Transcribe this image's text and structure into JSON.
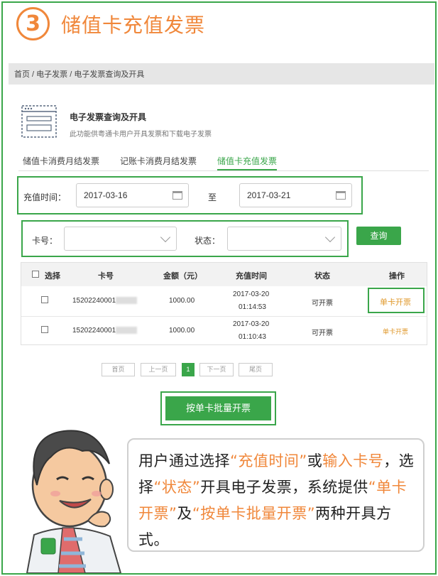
{
  "header": {
    "step": "3",
    "title": "储值卡充值发票"
  },
  "breadcrumb": "首页 / 电子发票 / 电子发票查询及开具",
  "page": {
    "title": "电子发票查询及开具",
    "desc": "此功能供粤通卡用户开具发票和下载电子发票"
  },
  "tabs": [
    {
      "label": "储值卡消费月结发票",
      "active": false
    },
    {
      "label": "记账卡消费月结发票",
      "active": false
    },
    {
      "label": "储值卡充值发票",
      "active": true
    }
  ],
  "filters": {
    "time_label": "充值时间：",
    "start_date": "2017-03-16",
    "to_label": "至",
    "end_date": "2017-03-21",
    "card_label": "卡号：",
    "status_label": "状态：",
    "query_button": "查询"
  },
  "table": {
    "headers": [
      "选择",
      "卡号",
      "金额（元）",
      "充值时间",
      "状态",
      "操作"
    ],
    "rows": [
      {
        "card": "15202240001",
        "amount": "1000.00",
        "date": "2017-03-20",
        "time": "01:14:53",
        "status": "可开票",
        "action": "单卡开票"
      },
      {
        "card": "15202240001",
        "amount": "1000.00",
        "date": "2017-03-20",
        "time": "01:10:43",
        "status": "可开票",
        "action": "单卡开票"
      }
    ]
  },
  "pager": {
    "first": "首页",
    "prev": "上一页",
    "current": "1",
    "next": "下一页",
    "last": "尾页"
  },
  "batch_button": "按单卡批量开票",
  "bubble": {
    "p1": "用户通过选择",
    "q1": "“充值时间”",
    "p2": "或",
    "q2": "输入卡号",
    "p3": "，选择",
    "q3": "“状态”",
    "p4": "开具电子发票，系统提供",
    "q4": "“单卡开票”",
    "p5": "及",
    "q5": "“按单卡批量开票”",
    "p6": "两种开具方式。"
  },
  "colors": {
    "accent": "#3aa64a",
    "orange": "#f0873a",
    "link": "#e0992c"
  }
}
